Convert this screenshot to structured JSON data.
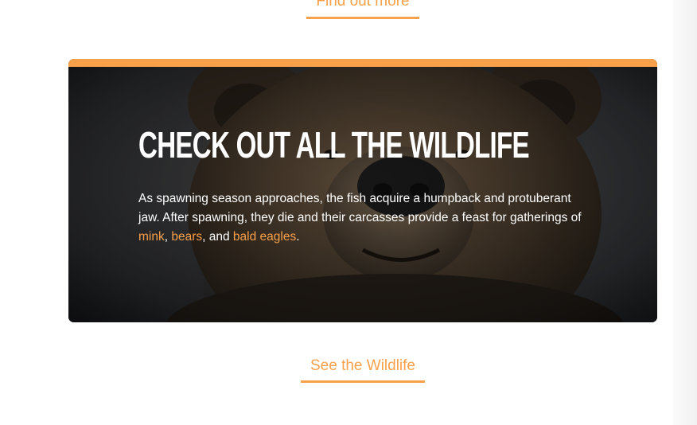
{
  "top_link": {
    "label": "Find out more"
  },
  "hero": {
    "title": "Check out all the wildlife",
    "text_before": "As spawning season approaches, the fish acquire a humpback and protuberant jaw. After spawning, they die and their carcasses provide a feast for gatherings of ",
    "link_mink": "mink",
    "sep_1": ", ",
    "link_bears": "bears",
    "sep_2": ", and ",
    "link_eagles": "bald eagles",
    "text_after": ".",
    "image_name": "bear-face-photo"
  },
  "bottom_link": {
    "label": "See the Wildlife"
  },
  "colors": {
    "accent": "#f9a04a",
    "hero_bg": "#2a2a2a",
    "text_on_dark": "#ffffff"
  }
}
